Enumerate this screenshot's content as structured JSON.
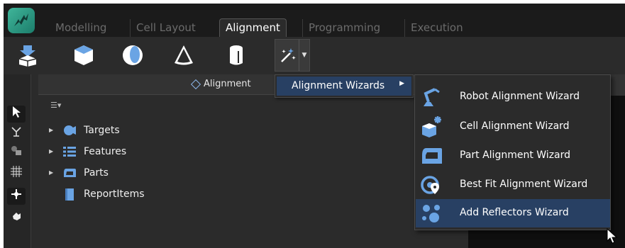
{
  "tabs": [
    "Modelling",
    "Cell Layout",
    "Alignment",
    "Programming",
    "Execution"
  ],
  "active_tab": "Alignment",
  "toolbar": {
    "tools": [
      "import-icon",
      "cube-icon",
      "sphere-icon",
      "cone-icon",
      "cylinder-icon",
      "magic-wand-icon"
    ]
  },
  "left_tools": [
    "select-arrow-icon",
    "robot-pick-icon",
    "parts-icon",
    "grid-icon",
    "reflector-icon",
    "hand-icon"
  ],
  "panel": {
    "title": "Alignment",
    "tree": [
      {
        "label": "Targets",
        "icon": "target-icon",
        "expandable": true
      },
      {
        "label": "Features",
        "icon": "list-icon",
        "expandable": true
      },
      {
        "label": "Parts",
        "icon": "part-icon",
        "expandable": true
      },
      {
        "label": "ReportItems",
        "icon": "report-icon",
        "expandable": false
      }
    ]
  },
  "menu": {
    "label": "Alignment Wizards",
    "submenu": [
      {
        "label": "Robot Alignment Wizard",
        "icon": "robot-arm-icon",
        "highlighted": false
      },
      {
        "label": "Cell Alignment Wizard",
        "icon": "cell-cube-icon",
        "highlighted": false
      },
      {
        "label": "Part Alignment Wizard",
        "icon": "part-shape-icon",
        "highlighted": false
      },
      {
        "label": "Best Fit Alignment Wizard",
        "icon": "best-fit-icon",
        "highlighted": false
      },
      {
        "label": "Add Reflectors Wizard",
        "icon": "reflectors-icon",
        "highlighted": true
      }
    ]
  },
  "colors": {
    "highlight": "#284063",
    "background": "#2b2b2b",
    "tabbar": "#1b1b1b",
    "icon_blue": "#6aa4e4"
  }
}
